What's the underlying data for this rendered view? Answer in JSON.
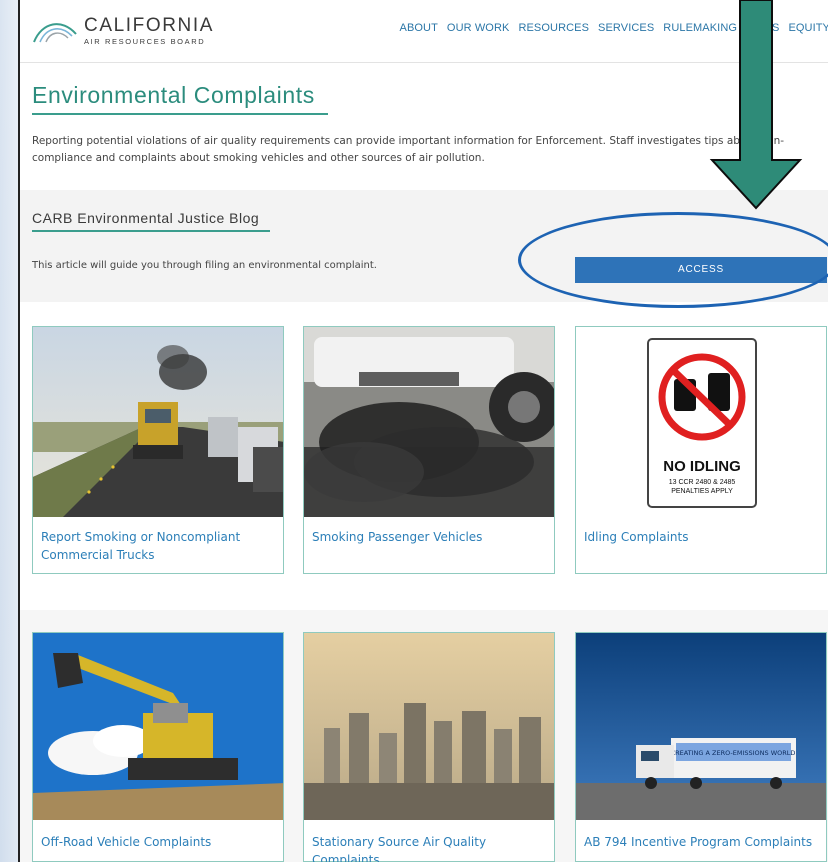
{
  "header": {
    "logo_main": "CALIFORNIA",
    "logo_sub": "AIR RESOURCES BOARD",
    "nav": [
      "ABOUT",
      "OUR WORK",
      "RESOURCES",
      "SERVICES",
      "RULEMAKING",
      "NEWS",
      "EQUITY"
    ]
  },
  "main": {
    "title": "Environmental Complaints",
    "intro": "Reporting potential violations of air quality requirements can provide important information for Enforcement. Staff investigates tips about non-compliance and complaints about smoking vehicles and other sources of air pollution."
  },
  "blog": {
    "title": "CARB Environmental Justice Blog",
    "text": "This article will guide you through filing an environmental complaint.",
    "button": "ACCESS"
  },
  "cards": [
    {
      "label": "Report Smoking or Noncompliant Commercial Trucks"
    },
    {
      "label": "Smoking Passenger Vehicles"
    },
    {
      "label": "Idling Complaints"
    },
    {
      "label": "Off-Road Vehicle Complaints"
    },
    {
      "label": "Stationary Source Air Quality Complaints"
    },
    {
      "label": "AB 794 Incentive Program Complaints"
    }
  ],
  "sign": {
    "heading": "NO IDLING",
    "line1": "13 CCR 2480 & 2485",
    "line2": "PENALTIES APPLY"
  },
  "truck_banner": "CREATING A ZERO-EMISSIONS WORLD",
  "colors": {
    "accent": "#2b8c7d",
    "link": "#2c7fb8",
    "button": "#2e73b8",
    "arrow": "#2e8b78",
    "highlight": "#1d63b3"
  }
}
